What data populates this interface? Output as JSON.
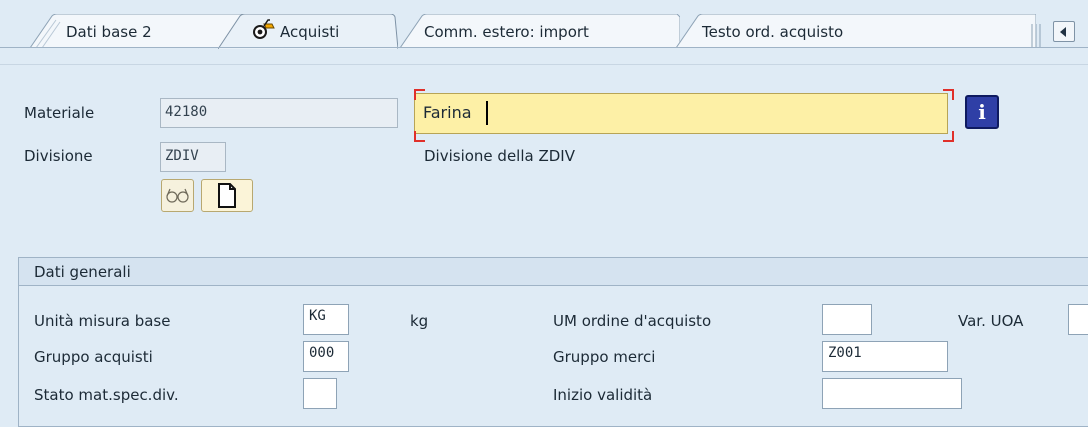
{
  "tabs": [
    {
      "label": "Dati base 2",
      "active": false
    },
    {
      "label": "Acquisti",
      "active": true
    },
    {
      "label": "Comm. estero: import",
      "active": false
    },
    {
      "label": "Testo ord. acquisto",
      "active": false
    }
  ],
  "header": {
    "material_label": "Materiale",
    "material_value": "42180",
    "material_description": "Farina",
    "plant_label": "Divisione",
    "plant_value": "ZDIV",
    "plant_description": "Divisione della ZDIV"
  },
  "general_data": {
    "title": "Dati generali",
    "base_uom_label": "Unità misura base",
    "base_uom_value": "KG",
    "base_uom_text": "kg",
    "order_uom_label": "UM ordine d'acquisto",
    "order_uom_value": "",
    "var_uoa_label": "Var. UOA",
    "var_uoa_value": "",
    "purch_group_label": "Gruppo acquisti",
    "purch_group_value": "000",
    "material_group_label": "Gruppo merci",
    "material_group_value": "Z001",
    "plant_status_label": "Stato mat.spec.div.",
    "plant_status_value": "",
    "valid_from_label": "Inizio validità",
    "valid_from_value": ""
  },
  "icons": {
    "tab_icon": "glasses-icon",
    "info": "info-icon",
    "display": "glasses-icon",
    "new": "document-icon"
  },
  "colors": {
    "background": "#dfebf5",
    "required_field": "#fdf0a6",
    "info_button": "#2f3fa6",
    "focus_corner": "#e0302a"
  }
}
